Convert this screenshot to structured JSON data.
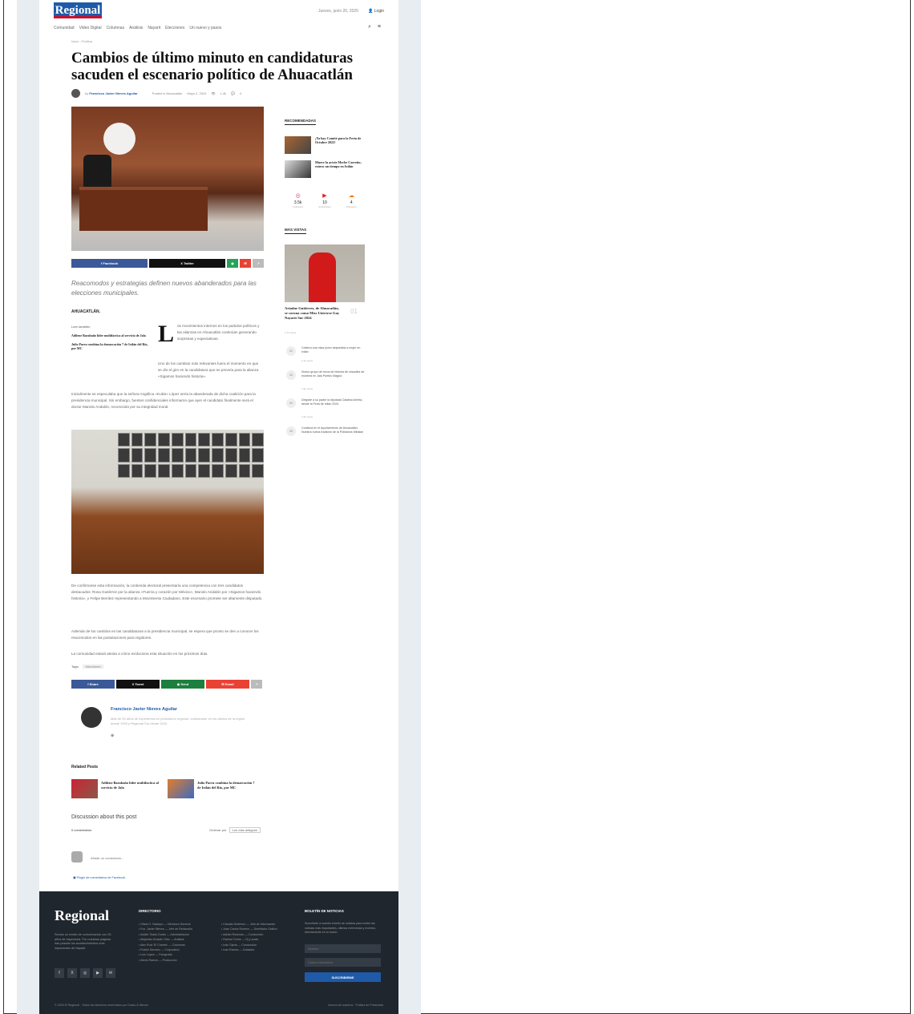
{
  "header": {
    "logo": "Regional",
    "date": "Jueves, junio 26, 2025",
    "login": "Login"
  },
  "nav": {
    "items": [
      "Comunidad",
      "Video Digital",
      "Columnas",
      "Análisis",
      "Nayarit",
      "Elecciones",
      "Un nuevo y pasos"
    ]
  },
  "article": {
    "breadcrumb": "Inicio › Política",
    "title": "Cambios de último minuto en candidaturas sacuden el escenario político de Ahuacatlán",
    "author": "Francisco Javier Nieves Aguilar",
    "posted_in": "Posted in Ahuacatlán",
    "date": "Mayo 2, 2024",
    "views": "1.4k",
    "comments": "0",
    "subtitle": "Reacomodos y estrategias definen nuevos abanderados para las elecciones municipales.",
    "place": "AHUACATLÁN.",
    "dropcap": "L",
    "p1": "os movimientos internos en los partidos políticos y las alianzas en Ahuacatlán continúan generando sorpresas y expectativas.",
    "p2": "Uno de los cambios más relevantes fuera el momento en que se dio el giro en la candidatura que se preveía para la alianza «Sigamos haciendo historia».",
    "p3": "Inicialmente se especulaba que la señora Angélica «Kukis» López sería la abanderada de dicha coalición para la presidencia municipal. Sin embargo, fuentes confidenciales informaron que ayer el candidato finalmente será el doctor Manolo Andalón, reconocido por su integridad moral.",
    "p4": "De confirmarse esta información, la contienda electoral presentaría una competencia con tres candidatos destacados: Rosa Gutiérrez por la alianza «Fuerza y corazón por México», Manolo Andalón por «Sigamos haciendo historia», y Felipe Benítez representando a Movimiento Ciudadano. Este escenario promete ser altamente disputado.",
    "p5": "Además de los cambios en las candidaturas a la presidencia municipal, se espera que pronto se den a conocer los reacomodos en las postulaciones para regidores.",
    "p6": "La comunidad estará atenta a cómo evoluciona esta situación en los próximos días.",
    "tags_label": "Tags:",
    "tag": "elecciones"
  },
  "leer": {
    "label": "Leer también",
    "items": [
      "Adilene Barabaño líder multifactica al servicio de Jala",
      "Julio Parra combina la demarcación 7 de Ixtlán del Río, por MC"
    ]
  },
  "share_top": [
    "Facebook",
    "Twitter"
  ],
  "share_bottom": [
    "Share",
    "Tweet",
    "Send",
    "Email"
  ],
  "author_box": {
    "name": "Francisco Javier Nieves Aguilar",
    "bio": "Más de 30 años de experiencia en periodismo regional, colaborador en los diarios de la región desde 1993 y Regional Sur desde 2010."
  },
  "related": {
    "heading": "Related Posts",
    "items": [
      "Adilene Barabaño líder multifactica al servicio de Jala",
      "Julio Parra combina la demarcación 7 de Ixtlán del Río, por MC"
    ]
  },
  "discussion": {
    "heading": "Discussion about this post",
    "count": "0 comentarios",
    "sort_label": "Ordenar por",
    "sort_value": "Los más antiguos",
    "placeholder": "Añadir un comentario...",
    "plugin": "Plugin de comentarios de Facebook"
  },
  "sidebar": {
    "rec_heading": "RECOMENDADAS",
    "rec": [
      "¡Ya hay Comité para la Feria de Octubre 2022!",
      "Muere la actriz Meche Carreño; estuvo un tiempo en Ixtlán"
    ],
    "social": [
      {
        "icon": "◎",
        "count": "3.5k",
        "label": "Followers",
        "color": "#e1306c"
      },
      {
        "icon": "▶",
        "count": "10",
        "label": "Subscribers",
        "color": "#e62117"
      },
      {
        "icon": "☁",
        "count": "4",
        "label": "Followers",
        "color": "#ff7700"
      }
    ],
    "mv_heading": "MÁS VISTAS",
    "mv_title": "Ariadne Gutiérrez, de Ahuacatlán, se corona como Miss Universe Gay Nayarit Sur 2024",
    "mv_num": "01",
    "mv_meta": "2.7k views",
    "mv_items": [
      {
        "n": "02",
        "text": "Celebra una misa joven despedida a mujer en Ixtlán",
        "meta": "2.1k views"
      },
      {
        "n": "03",
        "text": "Nuevo grupo de rezos de historia de chaudies de montera en Jala Pueblo Mágico",
        "meta": "1.9k views"
      },
      {
        "n": "04",
        "text": "Despide a su padre la diputada Catalina Arrieta, desde la Feria de Ixtlán 2024",
        "meta": "1.6k views"
      },
      {
        "n": "05",
        "text": "Continúa en el Ayuntamiento de Ahuacatlán: Nuestra nueva tradición de la Poblamos Mihaian",
        "meta": ""
      }
    ]
  },
  "footer": {
    "logo": "Regional",
    "desc": "Somos un medio de comunicación con 26 años de trayectoria. Por nuestras páginas han pasado los acontecimientos más importantes de Nayarit.",
    "social": [
      "f",
      "X",
      "◎",
      "▶",
      "✉"
    ],
    "dir_heading": "DIRECTORIO",
    "dir1": [
      "Olivia H. Ocampo — Directora General",
      "Fco. Javier Nieves — Jefe de Redacción",
      "Adolfo Tirado Durán — Administración",
      "Alejandro Arcadio Ortiz — Análisis",
      "Alex Ruiz 'El Charles' — Columnas",
      "Rubén Serrano — Corporativo",
      "Luis López — Fotografía",
      "Alexis Ramos — Producción"
    ],
    "dir2": [
      "Claudia Gutiérrez — Jefa de Información",
      "Juan Carlos Romero — Diseñador Gráfico",
      "Adrián Rosendo — Conducción",
      "Ramón Torres — Dj y audio",
      "Iván Ojeda — Conducción",
      "Iván Ramos — Doblador"
    ],
    "news_heading": "BOLETÍN DE NOTICIAS",
    "news_desc": "Suscríbete a nuestro boletín de noticias para recibir las noticias más importantes, últimas entrevistas y eventos, directamente en tu buzón.",
    "name_ph": "Nombre",
    "email_ph": "Correo electrónico",
    "btn": "SUSCRIBIRME",
    "copyright": "© 2025 El Regional - Todos los derechos reservados por Ocaso & Nieves",
    "links": "Acerca de nosotros · Política de Privacidad"
  }
}
